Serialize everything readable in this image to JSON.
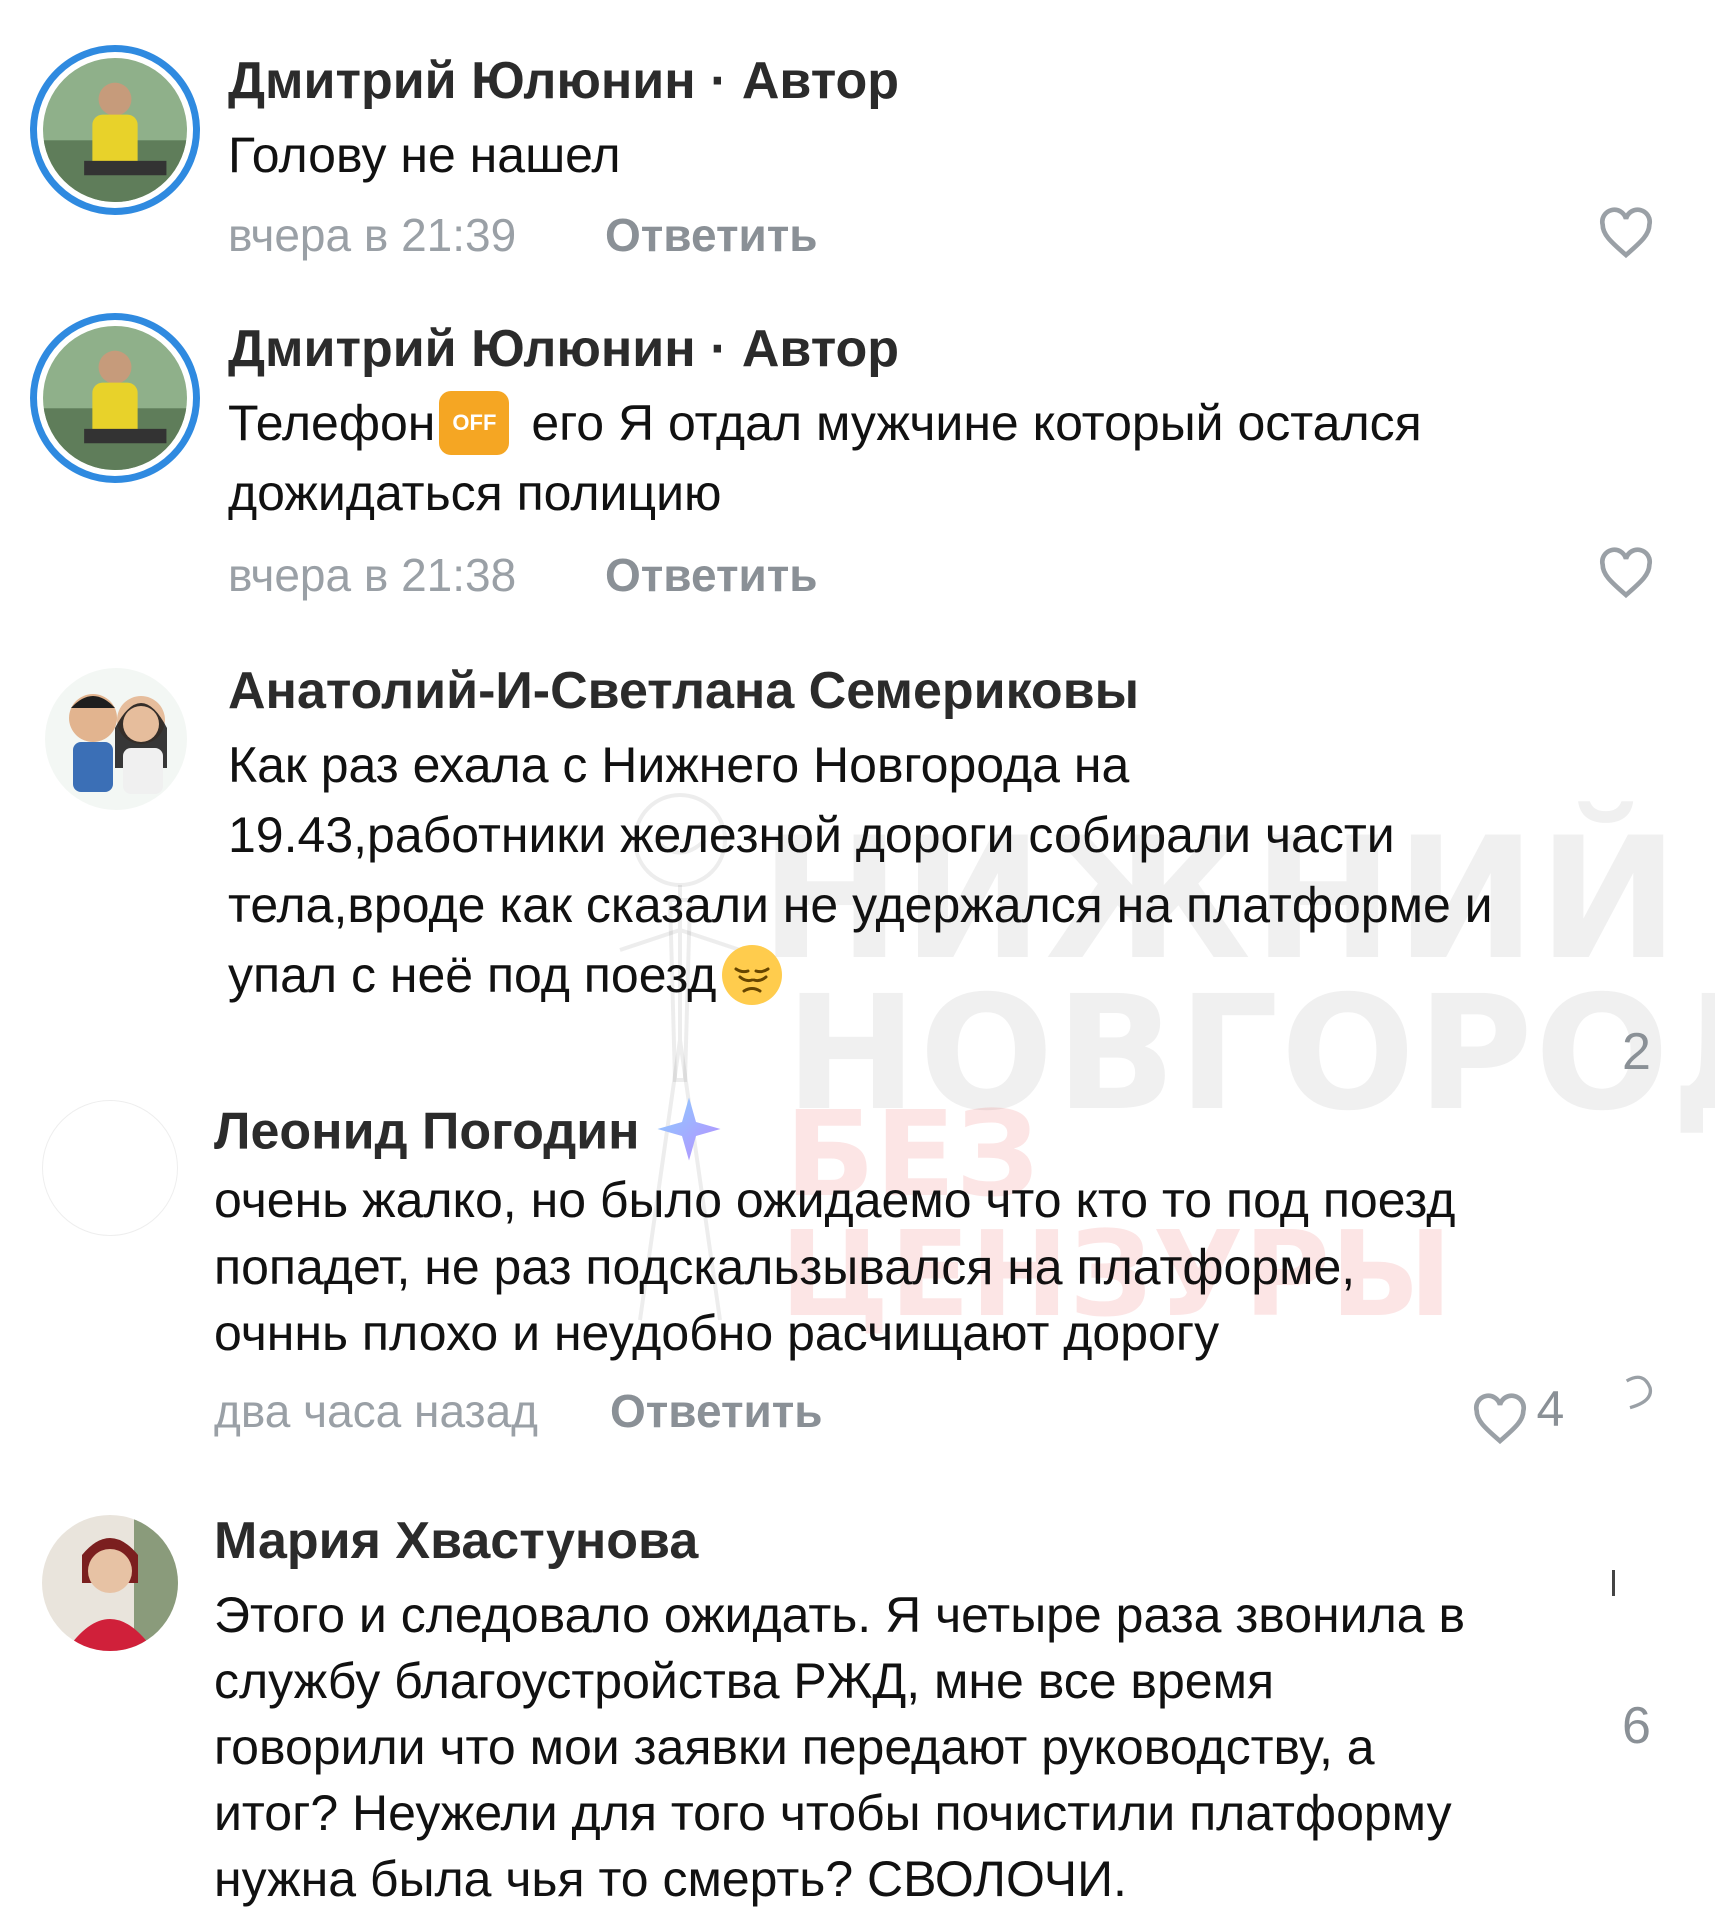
{
  "watermark": {
    "line1": "НИЖНИЙ",
    "line2": "НОВГОРОД",
    "line3": "БЕЗ",
    "line4": "ЦЕНЗУРЫ"
  },
  "comments": [
    {
      "author": "Дмитрий Юлюнин",
      "author_tag": " · Автор",
      "lines": [
        "Голову не нашел"
      ],
      "time": "вчера в 21:39",
      "reply_label": "Ответить"
    },
    {
      "author": "Дмитрий Юлюнин",
      "author_tag": " · Автор",
      "line1_before": "Телефон",
      "badge_text": "OFF",
      "line1_after": " его Я отдал мужчине который остался",
      "line2": "дожидаться полицию",
      "time": "вчера в 21:38",
      "reply_label": "Ответить"
    },
    {
      "author": "Анатолий-И-Светлана Семериковы",
      "lines": [
        "Как раз ехала с Нижнего Новгорода на",
        "19.43,работники железной дороги собирали части",
        "тела,вроде как сказали не удержался на платформе и"
      ],
      "last_line": "упал  с неё под поезд"
    },
    {
      "author": "Леонид Погодин",
      "lines": [
        "очень жалко, но было ожидаемо что кто то под поезд",
        "попадет, не раз подскальзывался на платформе,",
        "очннь плохо и неудобно расчищают дорогу"
      ],
      "time": "два часа назад",
      "reply_label": "Ответить",
      "likes": "4"
    },
    {
      "author": "Мария Хвастунова",
      "lines": [
        "Этого и следовало ожидать. Я четыре раза звонила в",
        "службу благоустройства РЖД, мне все время",
        "говорили что мои заявки передают руководству, а",
        "итог? Неужели для того чтобы почистили платформу",
        "нужна была чья то смерть? СВОЛОЧИ."
      ]
    }
  ],
  "right_edge": {
    "num_a": "2",
    "num_b": "6"
  },
  "colors": {
    "avatar_ring": "#2f8ae0",
    "badge": "#f5a623",
    "meta_gray": "#9aa0a6"
  },
  "icons": [
    "heart-icon",
    "phone-off-emoji",
    "pensive-face-emoji",
    "sparkle-star-icon"
  ]
}
